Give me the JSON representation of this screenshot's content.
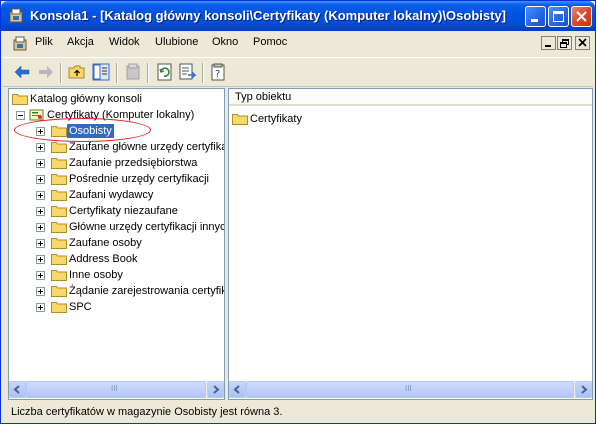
{
  "window": {
    "title": "Konsola1 - [Katalog główny konsoli\\Certyfikaty (Komputer lokalny)\\Osobisty]",
    "menu": [
      "Plik",
      "Akcja",
      "Widok",
      "Ulubione",
      "Okno",
      "Pomoc"
    ]
  },
  "tree": {
    "root": "Katalog główny konsoli",
    "certs_node": "Certyfikaty (Komputer lokalny)",
    "items": [
      "Osobisty",
      "Zaufane główne urzędy certyfikacji",
      "Zaufanie przedsiębiorstwa",
      "Pośrednie urzędy certyfikacji",
      "Zaufani wydawcy",
      "Certyfikaty niezaufane",
      "Główne urzędy certyfikacji innych firm",
      "Zaufane osoby",
      "Address Book",
      "Inne osoby",
      "Żądanie zarejestrowania certyfikatu",
      "SPC"
    ],
    "selected": "Osobisty"
  },
  "list": {
    "column_header": "Typ obiektu",
    "items": [
      "Certyfikaty"
    ]
  },
  "status": "Liczba certyfikatów w magazynie Osobisty jest równa 3.",
  "scrollbar_grip": "III",
  "colors": {
    "title_bar": "#0054e3",
    "selection": "#316ac5",
    "folder": "#f7d869",
    "annotation_circle": "#e02020"
  }
}
